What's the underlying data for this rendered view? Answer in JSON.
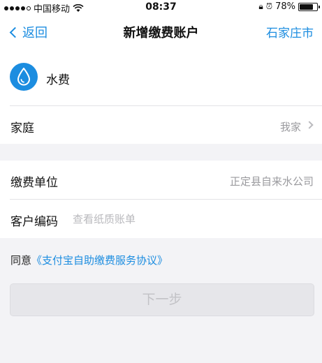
{
  "status_bar": {
    "carrier": "中国移动",
    "time": "08:37",
    "battery": "78%",
    "battery_level": 0.78
  },
  "nav": {
    "back_label": "返回",
    "title": "新增缴费账户",
    "city": "石家庄市"
  },
  "service": {
    "name": "水费",
    "icon": "water-drop-icon",
    "icon_color": "#1c8de0"
  },
  "group": {
    "label": "家庭",
    "value": "我家"
  },
  "payment_unit": {
    "label": "缴费单位",
    "value": "正定县自来水公司"
  },
  "customer_code": {
    "label": "客户编码",
    "placeholder": "查看纸质账单",
    "value": ""
  },
  "agreement": {
    "prefix": "同意",
    "link": "《支付宝自助缴费服务协议》"
  },
  "next_button": {
    "label": "下一步"
  },
  "colors": {
    "accent": "#1c8de0",
    "background": "#f3f3f6",
    "disabled_text": "#c2c2c6"
  }
}
